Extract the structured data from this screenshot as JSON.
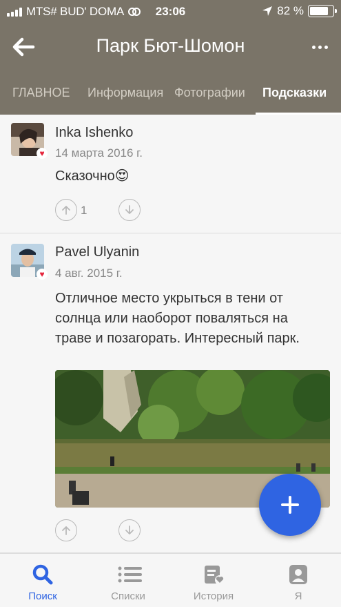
{
  "status_bar": {
    "carrier": "MTS# BUD' DOMA",
    "time": "23:06",
    "battery": "82 %",
    "battery_level": 0.82
  },
  "nav": {
    "title": "Парк Бют-Шомон",
    "back_icon": "arrow-left-icon",
    "more_icon": "more-horizontal-icon"
  },
  "tabs": [
    {
      "label": "ГЛАВНОЕ",
      "active": false
    },
    {
      "label": "Информация",
      "active": false
    },
    {
      "label": "Фотографии",
      "active": false
    },
    {
      "label": "Подсказки",
      "active": true
    }
  ],
  "tips": [
    {
      "author": "Inka Ishenko",
      "date": "14 марта 2016 г.",
      "text": "Сказочно😍",
      "upvotes": "1"
    },
    {
      "author": "Pavel Ulyanin",
      "date": "4 авг. 2015 г.",
      "text": "Отличное место укрыться в тени от солнца или наоборот поваляться на траве и позагорать. Интересный парк.",
      "upvotes": ""
    }
  ],
  "fab_icon": "plus-icon",
  "bottom_nav": [
    {
      "label": "Поиск",
      "icon": "search-icon",
      "active": true
    },
    {
      "label": "Списки",
      "icon": "list-icon",
      "active": false
    },
    {
      "label": "История",
      "icon": "history-icon",
      "active": false
    },
    {
      "label": "Я",
      "icon": "profile-icon",
      "active": false
    }
  ],
  "colors": {
    "header": "#7a7468",
    "accent": "#2f64e2",
    "heart": "#e5243b"
  }
}
